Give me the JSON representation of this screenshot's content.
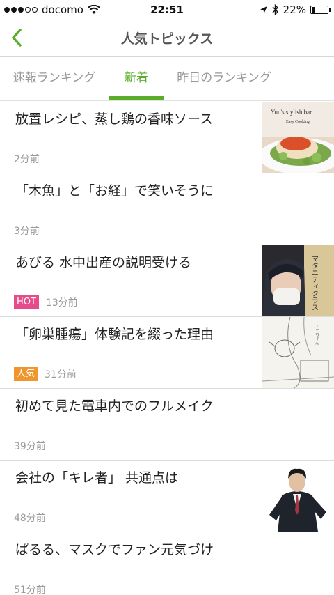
{
  "status_bar": {
    "carrier": "docomo",
    "time": "22:51",
    "battery_percent": "22%",
    "battery_level": 0.22,
    "signal_bars_filled": 3,
    "signal_bars_total": 5
  },
  "nav": {
    "title": "人気トピックス",
    "accent_color": "#5aad2b"
  },
  "tabs": [
    {
      "label": "速報ランキング",
      "active": false
    },
    {
      "label": "新着",
      "active": true
    },
    {
      "label": "昨日のランキング",
      "active": false
    }
  ],
  "thumbnail_texts": {
    "food_title": "Yuu's stylish bar",
    "food_subtitle": "Easy Cooking",
    "book_vertical": "マタニティクラス",
    "manga_label": "エモちゃん"
  },
  "items": [
    {
      "title": "放置レシピ、蒸し鶏の香味ソース",
      "time": "2分前",
      "badge": "",
      "thumbnail": "food-dish"
    },
    {
      "title": "「木魚」と「お経」で笑いそうに",
      "time": "3分前",
      "badge": "",
      "thumbnail": ""
    },
    {
      "title": "あびる 水中出産の説明受ける",
      "time": "13分前",
      "badge": "HOT",
      "thumbnail": "masked-woman"
    },
    {
      "title": "「卵巣腫瘍」体験記を綴った理由",
      "time": "31分前",
      "badge": "人気",
      "thumbnail": "manga-sketch"
    },
    {
      "title": "初めて見た電車内でのフルメイク",
      "time": "39分前",
      "badge": "",
      "thumbnail": ""
    },
    {
      "title": "会社の「キレ者」 共通点は",
      "time": "48分前",
      "badge": "",
      "thumbnail": "businessman"
    },
    {
      "title": "ぱるる、マスクでファン元気づけ",
      "time": "51分前",
      "badge": "",
      "thumbnail": ""
    }
  ]
}
